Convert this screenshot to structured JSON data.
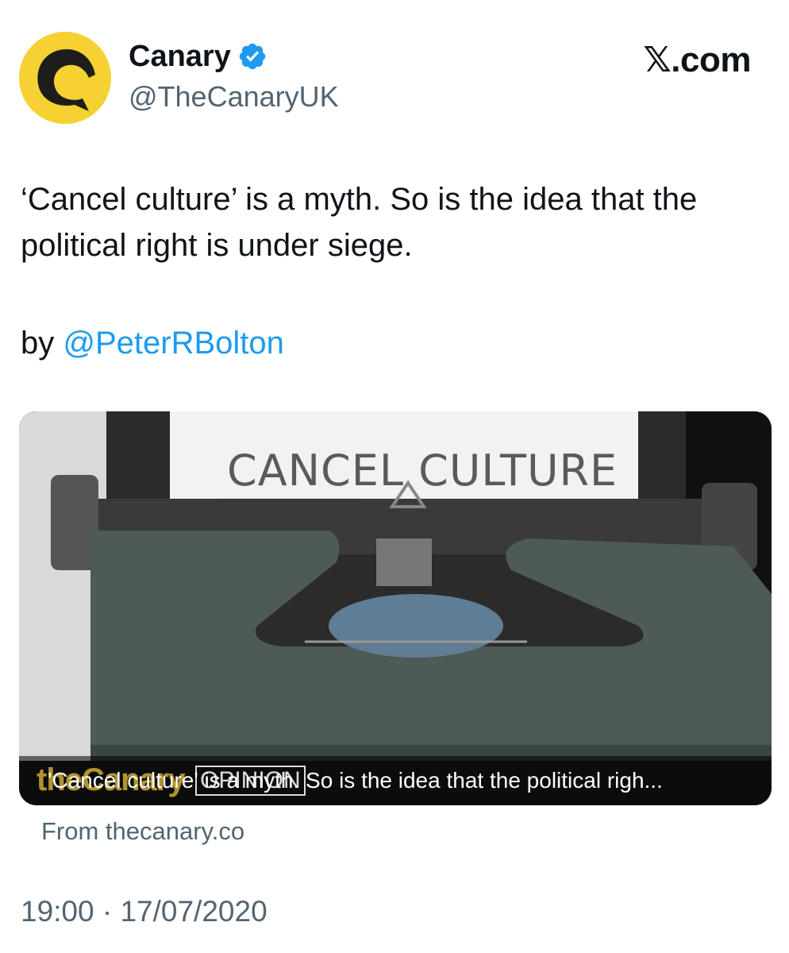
{
  "author": {
    "display_name": "Canary",
    "handle": "@TheCanaryUK",
    "avatar_icon": "canary-bird-logo",
    "verified_icon": "verified-badge-icon",
    "avatar_color": "#f5d231"
  },
  "brand": "𝕏.com",
  "tweet": {
    "text": "‘Cancel culture’ is a myth. So is the idea that the political right is under siege.",
    "byline_prefix": "by ",
    "byline_mention": "@PeterRBolton"
  },
  "card": {
    "paper_title": "CANCEL CULTURE",
    "caption_logo": "theCanary",
    "caption_tag": "OPINION",
    "caption_text": "'Cancel culture' is a myth. So is the idea that the political righ...",
    "source": "From thecanary.co"
  },
  "timestamp": "19:00 · 17/07/2020",
  "colors": {
    "link": "#1d9bf0",
    "secondary_text": "#536471",
    "verified": "#1d9bf0"
  }
}
